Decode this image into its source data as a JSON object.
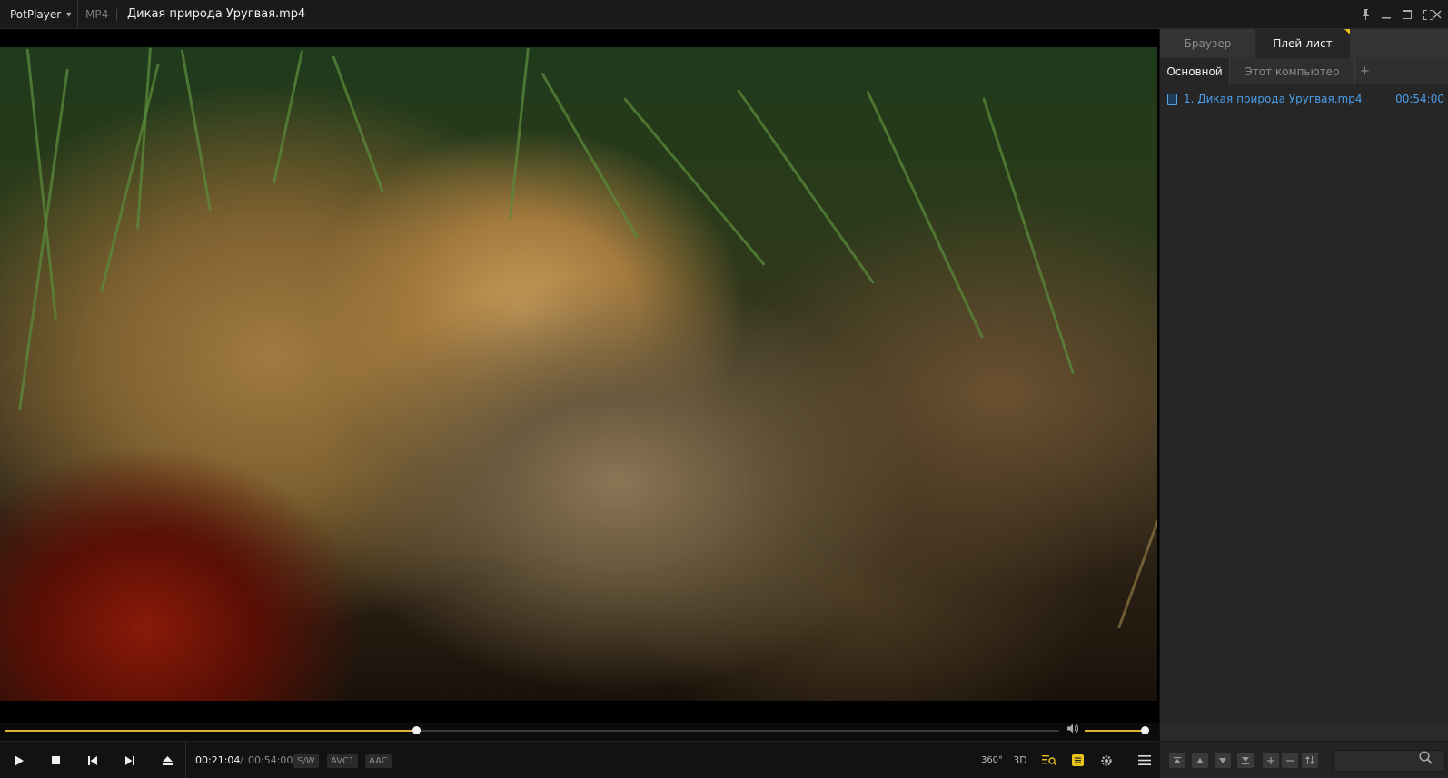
{
  "titlebar": {
    "app_name": "PotPlayer",
    "format": "MP4",
    "file_title": "Дикая природа Уругвая.mp4"
  },
  "icons": {
    "caret": "chevron-down-icon",
    "pin": "pin-icon",
    "minimize": "minimize-icon",
    "maximize": "maximize-icon",
    "fullscreen": "fullscreen-icon",
    "close": "close-icon"
  },
  "playback": {
    "position_fraction": 0.39,
    "volume_fraction": 1.0,
    "current_time": "00:21:04",
    "separator": "/",
    "duration": "00:54:00",
    "badges": {
      "decoder": "S/W",
      "video_codec": "AVC1",
      "audio_codec": "AAC"
    },
    "right_controls": {
      "vr_label": "360°",
      "stereo_label": "3D"
    }
  },
  "sidebar": {
    "tabs": [
      "Браузер",
      "Плей-лист"
    ],
    "active_tab": 1,
    "subtabs": [
      "Основной",
      "Этот компьютер"
    ],
    "active_subtab": 0,
    "add_label": "+",
    "playlist": [
      {
        "name": "1. Дикая природа Уругвая.mp4",
        "duration": "00:54:00"
      }
    ],
    "search_placeholder": ""
  },
  "colors": {
    "accent": "#e2b437",
    "link": "#4a9de8",
    "background": "#0b0b0b",
    "panel": "#2a2a2a"
  }
}
